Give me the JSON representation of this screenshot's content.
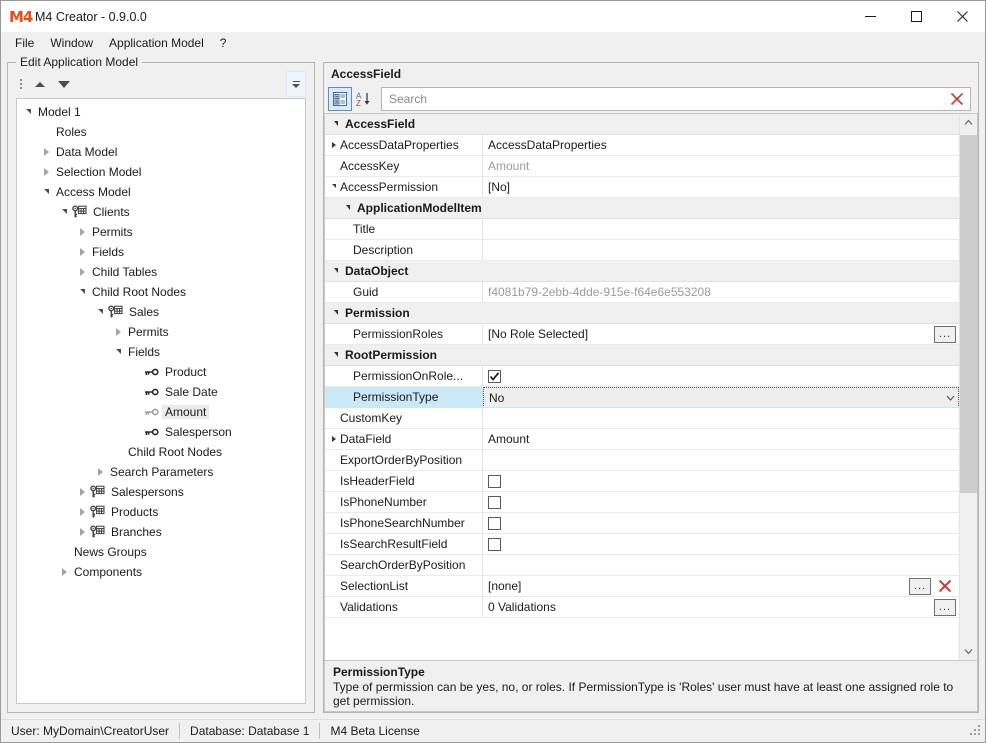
{
  "window": {
    "title": "M4 Creator - 0.9.0.0",
    "logo_text": "M4",
    "minimize": "–",
    "maximize": "□",
    "close": "×"
  },
  "menubar": {
    "items": [
      {
        "label": "File"
      },
      {
        "label": "Window"
      },
      {
        "label": "Application Model"
      },
      {
        "label": "?"
      }
    ]
  },
  "editor": {
    "groupbox_title": "Edit Application Model",
    "toolbar": {
      "move_up": "Move Up",
      "move_down": "Move Down",
      "overflow": "Toolbar Options"
    },
    "tree": [
      {
        "label": "Model 1",
        "depth": 0,
        "expander": "expanded",
        "icon": "none"
      },
      {
        "label": "Roles",
        "depth": 1,
        "expander": "none",
        "icon": "none"
      },
      {
        "label": "Data Model",
        "depth": 1,
        "expander": "collapsed",
        "icon": "none"
      },
      {
        "label": "Selection Model",
        "depth": 1,
        "expander": "collapsed",
        "icon": "none"
      },
      {
        "label": "Access Model",
        "depth": 1,
        "expander": "expanded",
        "icon": "none"
      },
      {
        "label": "Clients",
        "depth": 2,
        "expander": "expanded",
        "icon": "key-table"
      },
      {
        "label": "Permits",
        "depth": 3,
        "expander": "collapsed",
        "icon": "none"
      },
      {
        "label": "Fields",
        "depth": 3,
        "expander": "collapsed",
        "icon": "none"
      },
      {
        "label": "Child Tables",
        "depth": 3,
        "expander": "collapsed",
        "icon": "none"
      },
      {
        "label": "Child Root Nodes",
        "depth": 3,
        "expander": "expanded",
        "icon": "none"
      },
      {
        "label": "Sales",
        "depth": 4,
        "expander": "expanded",
        "icon": "key-table"
      },
      {
        "label": "Permits",
        "depth": 5,
        "expander": "collapsed",
        "icon": "none"
      },
      {
        "label": "Fields",
        "depth": 5,
        "expander": "expanded",
        "icon": "none"
      },
      {
        "label": "Product",
        "depth": 6,
        "expander": "none",
        "icon": "key"
      },
      {
        "label": "Sale Date",
        "depth": 6,
        "expander": "none",
        "icon": "key"
      },
      {
        "label": "Amount",
        "depth": 6,
        "expander": "none",
        "icon": "key",
        "selected": true
      },
      {
        "label": "Salesperson",
        "depth": 6,
        "expander": "none",
        "icon": "key"
      },
      {
        "label": "Child Root Nodes",
        "depth": 5,
        "expander": "none",
        "icon": "none"
      },
      {
        "label": "Search Parameters",
        "depth": 4,
        "expander": "collapsed",
        "icon": "none"
      },
      {
        "label": "Salespersons",
        "depth": 3,
        "expander": "collapsed",
        "icon": "key-table"
      },
      {
        "label": "Products",
        "depth": 3,
        "expander": "collapsed",
        "icon": "key-table"
      },
      {
        "label": "Branches",
        "depth": 3,
        "expander": "collapsed",
        "icon": "key-table"
      },
      {
        "label": "News Groups",
        "depth": 2,
        "expander": "none",
        "icon": "none"
      },
      {
        "label": "Components",
        "depth": 2,
        "expander": "collapsed",
        "icon": "none"
      }
    ]
  },
  "properties_panel": {
    "header": "AccessField",
    "toolbar": {
      "categorized_label": "Categorized",
      "alphabetical_label": "Alphabetical",
      "sort_a": "A",
      "sort_z": "Z"
    },
    "search": {
      "value": "",
      "placeholder": "Search",
      "clear_label": "Clear search"
    },
    "rows": [
      {
        "kind": "category",
        "name": "AccessField"
      },
      {
        "kind": "prop",
        "name": "AccessDataProperties",
        "value": "AccessDataProperties",
        "expander": "collapsed",
        "type": "text"
      },
      {
        "kind": "prop",
        "name": "AccessKey",
        "value": "Amount",
        "type": "text",
        "readonly": true
      },
      {
        "kind": "prop",
        "name": "AccessPermission",
        "value": "[No]",
        "expander": "expanded",
        "type": "text"
      },
      {
        "kind": "category",
        "name": "ApplicationModelItem",
        "indent": 1
      },
      {
        "kind": "prop",
        "name": "Title",
        "value": "",
        "type": "text",
        "indent": 1
      },
      {
        "kind": "prop",
        "name": "Description",
        "value": "",
        "type": "text",
        "indent": 1
      },
      {
        "kind": "category",
        "name": "DataObject"
      },
      {
        "kind": "prop",
        "name": "Guid",
        "value": "f4081b79-2ebb-4dde-915e-f64e6e553208",
        "type": "text",
        "readonly": true,
        "indent": 1
      },
      {
        "kind": "category",
        "name": "Permission"
      },
      {
        "kind": "prop",
        "name": "PermissionRoles",
        "value": "[No Role Selected]",
        "type": "ellipsis",
        "indent": 1
      },
      {
        "kind": "category",
        "name": "RootPermission"
      },
      {
        "kind": "prop",
        "name": "PermissionOnRole...",
        "value": "",
        "type": "checkbox",
        "checked": true,
        "indent": 1
      },
      {
        "kind": "prop",
        "name": "PermissionType",
        "value": "No",
        "type": "combobox",
        "selected": true,
        "indent": 1
      },
      {
        "kind": "prop",
        "name": "CustomKey",
        "value": "",
        "type": "text"
      },
      {
        "kind": "prop",
        "name": "DataField",
        "value": "Amount",
        "expander": "collapsed",
        "type": "text"
      },
      {
        "kind": "prop",
        "name": "ExportOrderByPosition",
        "value": "",
        "type": "text"
      },
      {
        "kind": "prop",
        "name": "IsHeaderField",
        "value": "",
        "type": "checkbox",
        "checked": false
      },
      {
        "kind": "prop",
        "name": "IsPhoneNumber",
        "value": "",
        "type": "checkbox",
        "checked": false
      },
      {
        "kind": "prop",
        "name": "IsPhoneSearchNumber",
        "value": "",
        "type": "checkbox",
        "checked": false
      },
      {
        "kind": "prop",
        "name": "IsSearchResultField",
        "value": "",
        "type": "checkbox",
        "checked": false
      },
      {
        "kind": "prop",
        "name": "SearchOrderByPosition",
        "value": "",
        "type": "text"
      },
      {
        "kind": "prop",
        "name": "SelectionList",
        "value": "[none]",
        "type": "ellipsis-clear"
      },
      {
        "kind": "prop",
        "name": "Validations",
        "value": "0 Validations",
        "type": "ellipsis"
      }
    ],
    "ellipsis_label": "...",
    "description": {
      "title": "PermissionType",
      "text": "Type of permission can be yes, no, or roles. If PermissionType is 'Roles' user must have at least one assigned role to get permission."
    }
  },
  "statusbar": {
    "user": "User: MyDomain\\CreatorUser",
    "database": "Database: Database 1",
    "license": "M4 Beta License"
  },
  "colors": {
    "accent": "#f04a16",
    "selection": "#cbe8f6",
    "tree_selection": "#ebebeb",
    "clear_red": "#cc3b33",
    "window_bg": "#f0f0f0"
  }
}
